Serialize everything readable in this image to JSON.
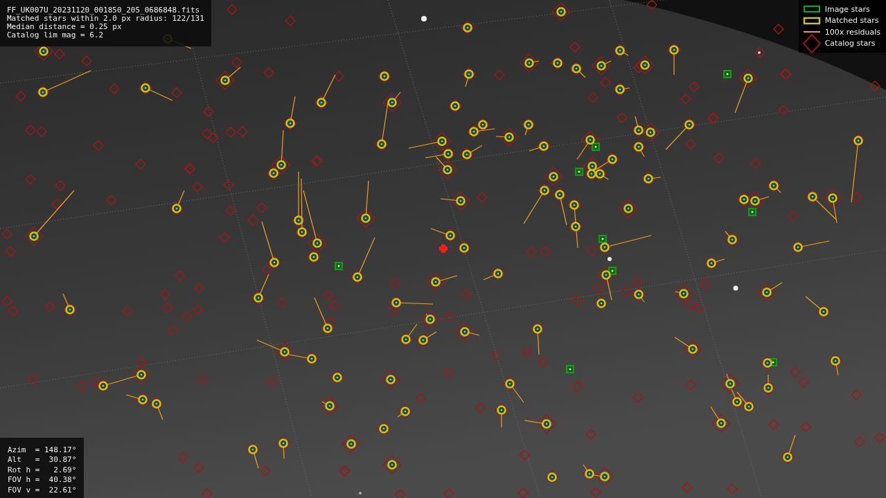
{
  "info_panel": {
    "lines": [
      "FF_UK007U_20231120_001850_205_0686848.fits",
      "Matched stars within 2.0 px radius: 122/131",
      "Median distance = 0.25 px",
      "Catalog lim mag = 6.2"
    ]
  },
  "legend": [
    {
      "kind": "rect",
      "label": "Image stars",
      "color": "#1a9a1a"
    },
    {
      "kind": "rect",
      "label": "Matched stars",
      "color": "#c8c81a"
    },
    {
      "kind": "line",
      "label": "100x residuals",
      "color": "#f0a020"
    },
    {
      "kind": "diamond",
      "label": "Catalog stars",
      "color": "#b01818"
    }
  ],
  "pointing_panel": {
    "lines": [
      "Azim  = 148.17°",
      "Alt   =  30.87°",
      "Rot h =   2.69°",
      "FOV h =  40.38°",
      "FOV v =  22.61°"
    ]
  }
}
